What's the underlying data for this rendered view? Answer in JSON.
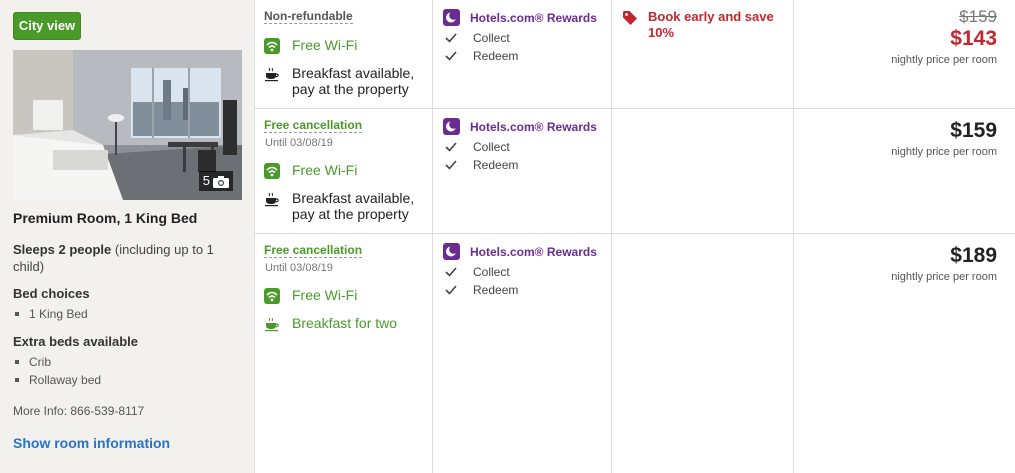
{
  "room": {
    "city_view_label": "City view",
    "photo_count": "5",
    "title": "Premium Room, 1 King Bed",
    "sleeps_bold": "Sleeps 2 people",
    "sleeps_rest": " (including up to 1 child)",
    "bed_choices_heading": "Bed choices",
    "bed_choices": [
      "1 King Bed"
    ],
    "extra_beds_heading": "Extra beds available",
    "extra_beds": [
      "Crib",
      "Rollaway bed"
    ],
    "more_info": "More Info: 866-539-8117",
    "show_room_link": "Show room information"
  },
  "rates": [
    {
      "policy": "Non-refundable",
      "policy_type": "nonrefundable",
      "wifi": "Free Wi-Fi",
      "breakfast": "Breakfast available, pay at the property",
      "rewards_label": "Hotels.com® Rewards",
      "collect": "Collect",
      "redeem": "Redeem",
      "promo": "Book early and save 10%",
      "old_price": "$159",
      "price": "$143",
      "price_note": "nightly price per room"
    },
    {
      "policy": "Free cancellation",
      "until": "Until 03/08/19",
      "wifi": "Free Wi-Fi",
      "breakfast": "Breakfast available, pay at the property",
      "rewards_label": "Hotels.com® Rewards",
      "collect": "Collect",
      "redeem": "Redeem",
      "price": "$159",
      "price_note": "nightly price per room"
    },
    {
      "policy": "Free cancellation",
      "until": "Until 03/08/19",
      "wifi": "Free Wi-Fi",
      "breakfast": "Breakfast for two",
      "rewards_label": "Hotels.com® Rewards",
      "collect": "Collect",
      "redeem": "Redeem",
      "price": "$189",
      "price_note": "nightly price per room"
    }
  ],
  "colors": {
    "green": "#4a9a2a",
    "purple": "#6a2c91",
    "red": "#c2262e",
    "link_blue": "#2a73c6"
  },
  "icons": [
    "camera-icon",
    "wifi-icon",
    "coffee-cup-icon",
    "moon-icon",
    "checkmark-icon",
    "price-tag-icon"
  ]
}
